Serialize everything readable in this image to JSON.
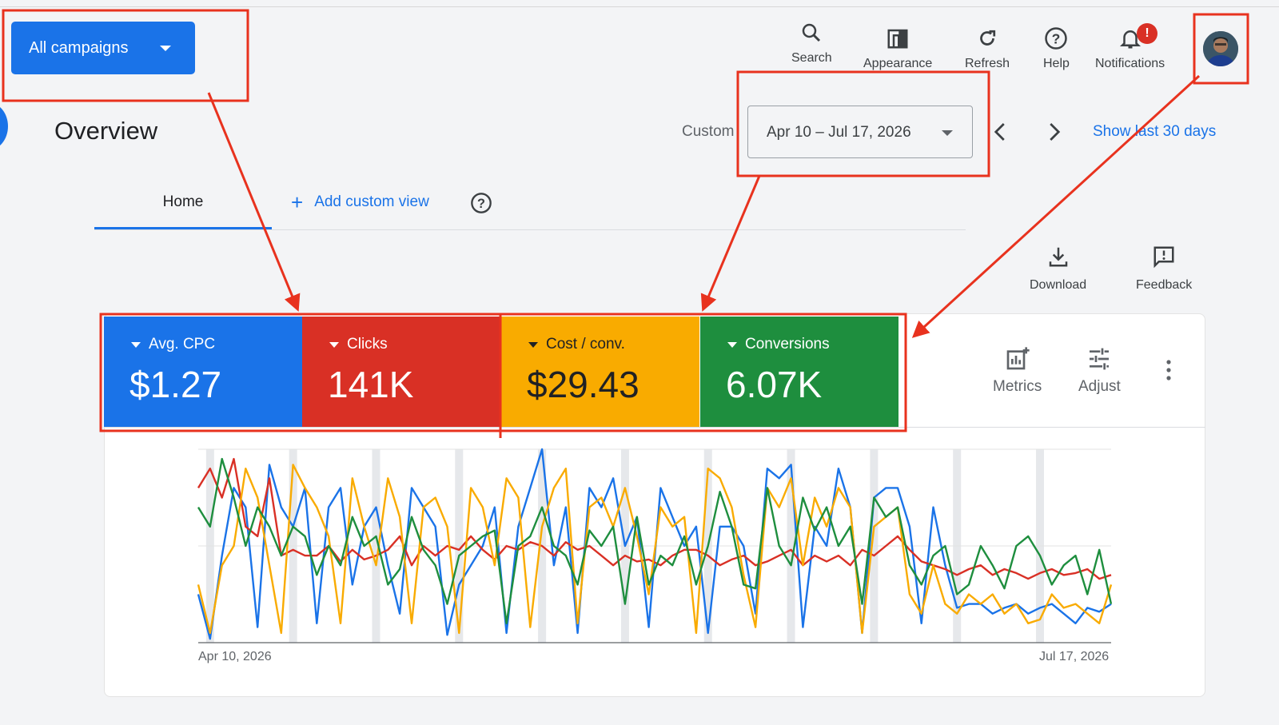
{
  "campaign_selector": {
    "label": "All campaigns"
  },
  "header": {
    "title": "Overview",
    "tools": [
      {
        "label": "Search",
        "icon": "search-icon"
      },
      {
        "label": "Appearance",
        "icon": "appearance-icon"
      },
      {
        "label": "Refresh",
        "icon": "refresh-icon"
      },
      {
        "label": "Help",
        "icon": "help-icon"
      },
      {
        "label": "Notifications",
        "icon": "bell-icon",
        "badge": "!"
      }
    ]
  },
  "date_range": {
    "label": "Custom",
    "value": "Apr 10 – Jul 17, 2026",
    "show_last": "Show last 30 days"
  },
  "tabs": {
    "home": "Home",
    "add_custom_view": "Add custom view"
  },
  "actions": {
    "download": "Download",
    "feedback": "Feedback"
  },
  "metrics": [
    {
      "label": "Avg. CPC",
      "value": "$1.27",
      "color": "#1a73e8",
      "text_color": "#ffffff"
    },
    {
      "label": "Clicks",
      "value": "141K",
      "color": "#d93025",
      "text_color": "#ffffff"
    },
    {
      "label": "Cost / conv.",
      "value": "$29.43",
      "color": "#f9ab00",
      "text_color": "#202124"
    },
    {
      "label": "Conversions",
      "value": "6.07K",
      "color": "#1e8e3e",
      "text_color": "#ffffff"
    }
  ],
  "card_tools": {
    "metrics": "Metrics",
    "adjust": "Adjust"
  },
  "chart_data": {
    "type": "line",
    "x_start": "Apr 10, 2026",
    "x_end": "Jul 17, 2026",
    "ylim": [
      0,
      100
    ],
    "series": [
      {
        "color": "#1a73e8",
        "values": [
          25,
          2,
          45,
          80,
          70,
          8,
          92,
          70,
          60,
          80,
          10,
          70,
          80,
          30,
          60,
          70,
          40,
          15,
          80,
          70,
          60,
          4,
          30,
          40,
          50,
          70,
          5,
          60,
          80,
          100,
          40,
          70,
          5,
          80,
          70,
          85,
          50,
          65,
          8,
          80,
          65,
          50,
          60,
          5,
          60,
          60,
          50,
          15,
          90,
          85,
          92,
          8,
          60,
          50,
          90,
          70,
          5,
          75,
          80,
          80,
          60,
          10,
          70,
          40,
          18,
          20,
          20,
          15,
          18,
          20,
          15,
          18,
          20,
          15,
          10,
          18,
          16,
          20
        ]
      },
      {
        "color": "#d93025",
        "values": [
          80,
          90,
          75,
          95,
          60,
          55,
          85,
          45,
          48,
          45,
          45,
          50,
          42,
          48,
          43,
          45,
          48,
          55,
          40,
          50,
          45,
          50,
          48,
          55,
          48,
          43,
          50,
          48,
          52,
          50,
          45,
          52,
          48,
          50,
          45,
          40,
          45,
          42,
          43,
          40,
          45,
          48,
          48,
          45,
          40,
          43,
          45,
          40,
          42,
          45,
          48,
          40,
          45,
          42,
          45,
          40,
          48,
          45,
          50,
          55,
          48,
          42,
          40,
          38,
          35,
          38,
          40,
          35,
          38,
          36,
          33,
          36,
          38,
          35,
          36,
          38,
          33,
          35
        ]
      },
      {
        "color": "#f9ab00",
        "values": [
          30,
          5,
          40,
          50,
          90,
          75,
          40,
          5,
          92,
          80,
          70,
          55,
          10,
          85,
          60,
          40,
          85,
          65,
          10,
          70,
          75,
          60,
          5,
          80,
          70,
          40,
          85,
          75,
          8,
          60,
          80,
          90,
          10,
          70,
          75,
          60,
          80,
          55,
          25,
          70,
          60,
          65,
          5,
          90,
          85,
          70,
          35,
          8,
          80,
          70,
          85,
          40,
          75,
          60,
          80,
          70,
          5,
          60,
          65,
          70,
          25,
          15,
          40,
          20,
          15,
          25,
          20,
          25,
          15,
          20,
          10,
          12,
          25,
          18,
          20,
          15,
          10,
          30
        ]
      },
      {
        "color": "#1e8e3e",
        "values": [
          70,
          60,
          95,
          75,
          50,
          70,
          60,
          45,
          60,
          55,
          35,
          50,
          40,
          65,
          50,
          55,
          30,
          38,
          65,
          48,
          40,
          20,
          45,
          50,
          55,
          58,
          10,
          50,
          55,
          70,
          50,
          45,
          30,
          58,
          50,
          60,
          20,
          65,
          30,
          45,
          40,
          55,
          30,
          50,
          78,
          60,
          30,
          28,
          80,
          50,
          40,
          75,
          58,
          70,
          50,
          60,
          20,
          75,
          65,
          70,
          40,
          30,
          45,
          50,
          25,
          30,
          50,
          40,
          28,
          50,
          55,
          45,
          30,
          40,
          45,
          25,
          48,
          20
        ]
      }
    ]
  }
}
